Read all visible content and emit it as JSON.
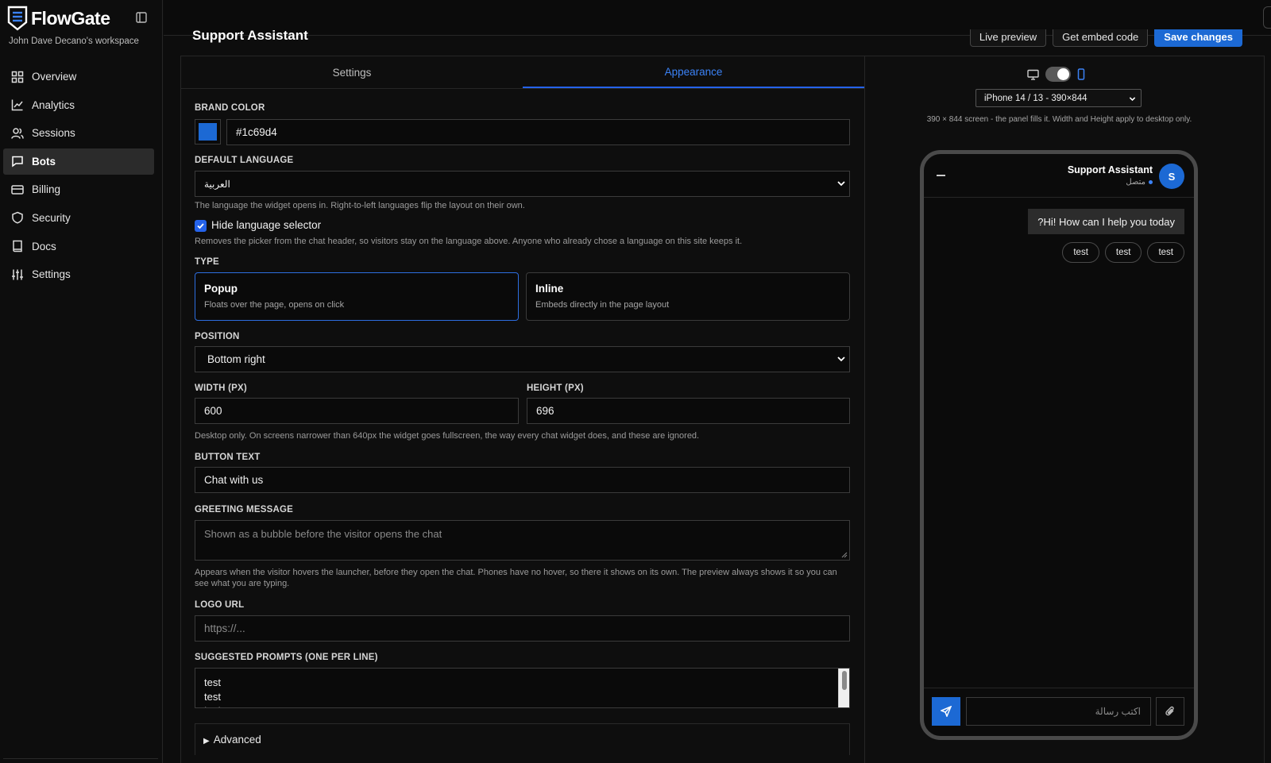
{
  "app": {
    "name": "FlowGate",
    "workspace": "John Dave Decano's workspace"
  },
  "nav": {
    "items": [
      {
        "label": "Overview",
        "icon": "grid-icon"
      },
      {
        "label": "Analytics",
        "icon": "chart-line-icon"
      },
      {
        "label": "Sessions",
        "icon": "users-icon"
      },
      {
        "label": "Bots",
        "icon": "message-icon",
        "active": true
      },
      {
        "label": "Billing",
        "icon": "credit-card-icon"
      },
      {
        "label": "Security",
        "icon": "shield-icon"
      },
      {
        "label": "Docs",
        "icon": "book-icon"
      },
      {
        "label": "Settings",
        "icon": "sliders-icon"
      }
    ]
  },
  "page": {
    "title": "Support Assistant"
  },
  "actions": {
    "live_preview": "Live preview",
    "embed": "Get embed code",
    "save": "Save changes"
  },
  "tabs": {
    "settings": "Settings",
    "appearance": "Appearance",
    "active": "Appearance"
  },
  "form": {
    "brand_color": {
      "label": "BRAND COLOR",
      "value": "#1c69d4",
      "swatch": "#1c69d4"
    },
    "language": {
      "label": "DEFAULT LANGUAGE",
      "value": "العربية",
      "help": "The language the widget opens in. Right-to-left languages flip the layout on their own."
    },
    "hide_selector": {
      "label": "Hide language selector",
      "checked": true,
      "help": "Removes the picker from the chat header, so visitors stay on the language above. Anyone who already chose a language on this site keeps it."
    },
    "type": {
      "label": "TYPE",
      "options": [
        {
          "title": "Popup",
          "desc": "Floats over the page, opens on click",
          "selected": true
        },
        {
          "title": "Inline",
          "desc": "Embeds directly in the page layout",
          "selected": false
        }
      ]
    },
    "position": {
      "label": "POSITION",
      "value": "Bottom right"
    },
    "width": {
      "label": "WIDTH (PX)",
      "value": "600"
    },
    "height": {
      "label": "HEIGHT (PX)",
      "value": "696"
    },
    "size_help": "Desktop only. On screens narrower than 640px the widget goes fullscreen, the way every chat widget does, and these are ignored.",
    "button_text": {
      "label": "BUTTON TEXT",
      "value": "Chat with us"
    },
    "greeting": {
      "label": "GREETING MESSAGE",
      "placeholder": "Shown as a bubble before the visitor opens the chat",
      "help": "Appears when the visitor hovers the launcher, before they open the chat. Phones have no hover, so there it shows on its own. The preview always shows it so you can see what you are typing."
    },
    "logo_url": {
      "label": "LOGO URL",
      "placeholder": "https://..."
    },
    "prompts": {
      "label": "SUGGESTED PROMPTS (ONE PER LINE)",
      "lines": [
        "test",
        "test",
        "test"
      ]
    },
    "advanced": "Advanced"
  },
  "preview": {
    "device": "iPhone 14 / 13 - 390×844",
    "help": "390 × 844 screen - the panel fills it. Width and Height apply to desktop only.",
    "mode": "mobile",
    "chat": {
      "title": "Support Assistant",
      "status": "متصل",
      "avatar": "S",
      "greeting": "?Hi! How can I help you today",
      "chips": [
        "test",
        "test",
        "test"
      ],
      "input_placeholder": "اكتب رسالة"
    }
  }
}
